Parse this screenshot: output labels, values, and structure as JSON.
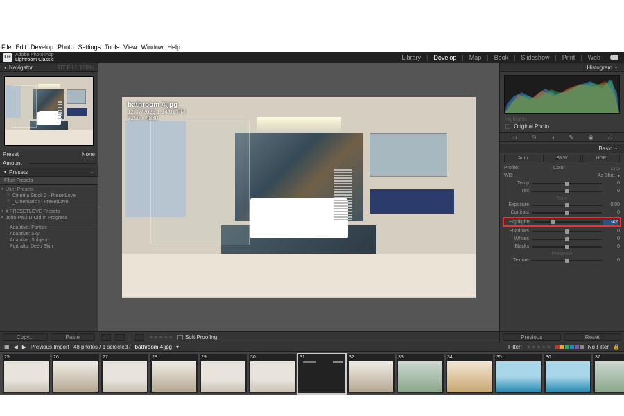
{
  "os_menu": [
    "File",
    "Edit",
    "Develop",
    "Photo",
    "Settings",
    "Tools",
    "View",
    "Window",
    "Help"
  ],
  "app": {
    "suite": "Adobe Photoshop",
    "product": "Lightroom Classic",
    "logo": "Lrc"
  },
  "modules": [
    "Library",
    "Develop",
    "Map",
    "Book",
    "Slideshow",
    "Print",
    "Web"
  ],
  "module_active": "Develop",
  "left": {
    "navigator": {
      "title": "Navigator",
      "modebar": "FIT  FILL  100%"
    },
    "preset_row": {
      "label": "Preset",
      "value": "None"
    },
    "amount_row": {
      "label": "Amount"
    },
    "presets": {
      "title": "Presets",
      "filter": "Filter Presets",
      "user_header": "User Presets",
      "items": [
        "Cinema Stock 2 - PresetLove",
        "_Cinematic I - PresetLove"
      ],
      "group1": "# PRESETLOVE Presets",
      "group2": "John-Paul D Old In Progress",
      "adapt1": "Adaptive: Portrait",
      "adapt2": "Adaptive: Sky",
      "adapt3": "Adaptive: Subject",
      "adapt4": "Portraits: Deep Skin"
    },
    "foot": {
      "copy": "Copy...",
      "paste": "Paste"
    }
  },
  "center": {
    "overlay": {
      "filename": "bathroom 4.jpg",
      "timestamp": "12/07/2023 1:14:01 PM",
      "dims": "7250 x 4830"
    },
    "toolbar": {
      "soft_proof": "Soft Proofing"
    }
  },
  "right": {
    "histogram": {
      "title": "Histogram"
    },
    "readout": "Highlights",
    "orig": " Original Photo",
    "tool_icons": [
      "▭",
      "⊙",
      "◑",
      "✎",
      "◉",
      "▱"
    ],
    "basic": {
      "title": "Basic",
      "treat": [
        "Auto",
        "B&W",
        "HDR"
      ],
      "profile": {
        "label": "Profile:",
        "value": "Color"
      },
      "wb": {
        "label": "WB:",
        "value": "As Shot"
      },
      "sliders": [
        {
          "label": "Temp",
          "value": 0,
          "pos": 50
        },
        {
          "label": "Tint",
          "value": 0,
          "pos": 50
        }
      ],
      "tone_label": "Tone",
      "tone": [
        {
          "label": "Exposure",
          "value": "0.00",
          "pos": 50
        },
        {
          "label": "Contrast",
          "value": 0,
          "pos": 50
        },
        {
          "label": "Highlights",
          "value": "-42",
          "pos": 29,
          "hi": true,
          "input": true
        },
        {
          "label": "Shadows",
          "value": 0,
          "pos": 50
        },
        {
          "label": "Whites",
          "value": 0,
          "pos": 50
        },
        {
          "label": "Blacks",
          "value": 0,
          "pos": 50
        }
      ],
      "presence_label": "Presence",
      "presence": [
        {
          "label": "Texture",
          "value": 0,
          "pos": 50
        }
      ]
    },
    "foot": {
      "previous": "Previous",
      "reset": "Reset"
    }
  },
  "strip": {
    "source": "Previous Import",
    "count": "48 photos / 1 selected /",
    "current": "bathroom 4.jpg",
    "filter_label": "Filter:",
    "nofilter": "No Filter",
    "label_colors": [
      "#c0392b",
      "#d9a436",
      "#27ae60",
      "#2c7fb8",
      "#7b5bb0",
      "#888"
    ],
    "thumbs": [
      {
        "idx": "25",
        "cls": "bg-a"
      },
      {
        "idx": "26",
        "cls": "bg-b"
      },
      {
        "idx": "27",
        "cls": "bg-a"
      },
      {
        "idx": "28",
        "cls": "bg-b"
      },
      {
        "idx": "29",
        "cls": "bg-a"
      },
      {
        "idx": "30",
        "cls": "bg-a"
      },
      {
        "idx": "31",
        "cls": "scene",
        "sel": true
      },
      {
        "idx": "32",
        "cls": "bg-b"
      },
      {
        "idx": "33",
        "cls": "bg-c"
      },
      {
        "idx": "34",
        "cls": "bg-d"
      },
      {
        "idx": "35",
        "cls": "bg-e"
      },
      {
        "idx": "36",
        "cls": "bg-e"
      },
      {
        "idx": "37",
        "cls": "bg-c"
      }
    ]
  }
}
